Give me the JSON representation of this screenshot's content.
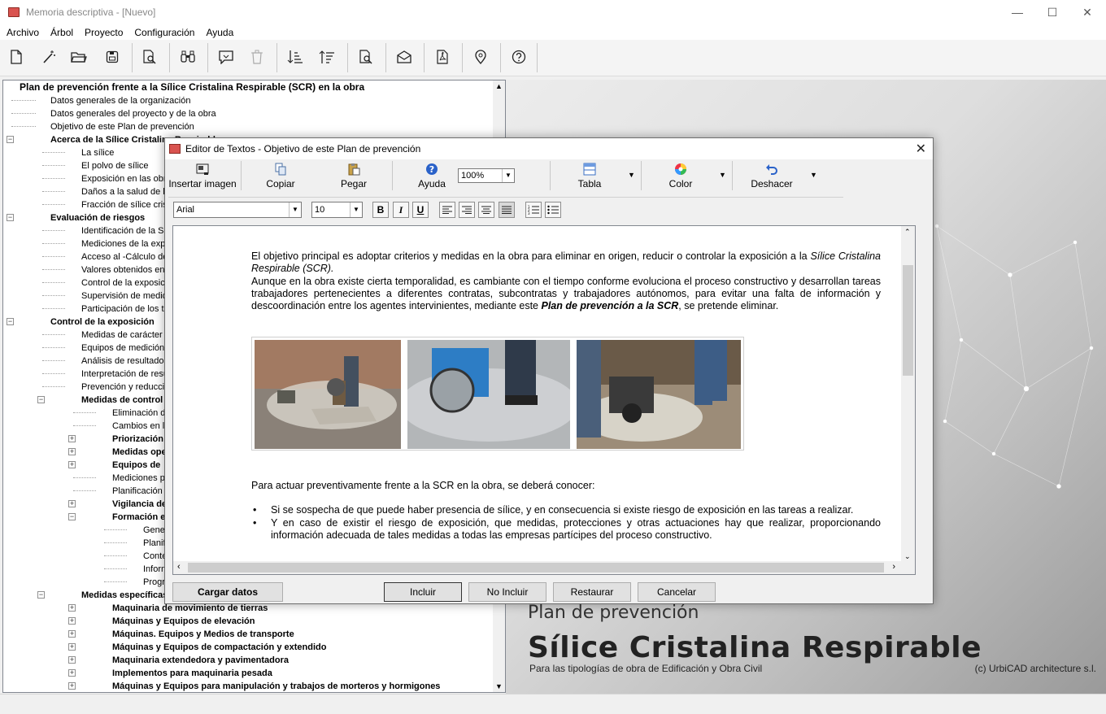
{
  "window": {
    "title": "Memoria descriptiva - [Nuevo]",
    "minimize": "—",
    "maximize": "☐",
    "close": "✕"
  },
  "menu": [
    "Archivo",
    "Árbol",
    "Proyecto",
    "Configuración",
    "Ayuda"
  ],
  "tree": {
    "root": "Plan de prevención frente a la Sílice Cristalina Respirable (SCR) en la obra",
    "items": [
      "Datos generales de la organización",
      "Datos generales del proyecto y de la obra",
      "Objetivo de este Plan de prevención",
      "Acerca de la Sílice Cristalina Respirable",
      "La sílice",
      "El polvo de sílice",
      "Exposición en las obras",
      "Daños a la salud de los trabajadores",
      "Fracción de sílice cristalina",
      "Evaluación de riesgos",
      "Identificación de la SCR",
      "Mediciones de la exposición",
      "Acceso al -Cálculo de",
      "Valores obtenidos en",
      "Control de la exposición",
      "Supervisión de medidas",
      "Participación de los trabajadores",
      "Control de la exposición",
      "Medidas de carácter general",
      "Equipos de medición",
      "Análisis de resultados",
      "Interpretación de resultados",
      "Prevención y reducción",
      "Medidas de control",
      "Eliminación de",
      "Cambios en los",
      "Priorización",
      "Medidas operativas",
      "Equipos de",
      "Mediciones periódicas",
      "Planificación",
      "Vigilancia de",
      "Formación e",
      "General",
      "Planificación",
      "Contenidos",
      "Información",
      "Programa",
      "Medidas específicas",
      "Maquinaria de movimiento de tierras",
      "Máquinas y Equipos de elevación",
      "Máquinas. Equipos y Medios de transporte",
      "Máquinas y Equipos de compactación y extendido",
      "Maquinaria extendedora y pavimentadora",
      "Implementos para maquinaria pesada",
      "Máquinas y Equipos para manipulación y trabajos de morteros y hormigones"
    ]
  },
  "background": {
    "title1": "Plan de prevención",
    "title2": "Sílice Cristalina Respirable",
    "subtitle": "Para las tipologías de obra de Edificación y Obra Civil",
    "copyright": "(c)  UrbiCAD architecture s.l."
  },
  "dialog": {
    "title": "Editor de Textos - Objetivo de este Plan de prevención",
    "close": "✕",
    "ribbon": {
      "insert_image": "Insertar imagen",
      "copy": "Copiar",
      "paste": "Pegar",
      "help": "Ayuda",
      "zoom": "100%",
      "table": "Tabla",
      "color": "Color",
      "undo": "Deshacer"
    },
    "format": {
      "font": "Arial",
      "size": "10",
      "bold": "B",
      "italic": "I",
      "underline": "U"
    },
    "document": {
      "p1_a": "El objetivo principal es adoptar criterios y medidas en la obra para eliminar en origen, reducir o controlar la exposición a la ",
      "p1_em": "Sílice Cristalina Respirable (SCR).",
      "p2_a": "Aunque en la obra existe cierta temporalidad, es cambiante con el tiempo conforme evoluciona el proceso constructivo y desarrollan tareas trabajadores pertenecientes a diferentes contratas, subcontratas y trabajadores autónomos, para evitar una falta de información y descoordinación entre los agentes intervinientes, mediante este ",
      "p2_b": "Plan de prevención a la SCR",
      "p2_c": ", se pretende eliminar.",
      "p3": "Para actuar preventivamente frente a la SCR en la obra, se deberá conocer:",
      "bullet1": "Si se sospecha de que puede haber presencia de sílice, y en consecuencia si existe riesgo de exposición en las tareas a realizar.",
      "bullet2": "Y en caso de existir el riesgo de exposición, que medidas, protecciones y otras actuaciones hay que realizar, proporcionando información adecuada de tales medidas a todas las empresas partícipes del proceso constructivo."
    },
    "buttons": {
      "load": "Cargar datos",
      "include": "Incluir",
      "exclude": "No Incluir",
      "restore": "Restaurar",
      "cancel": "Cancelar"
    }
  }
}
